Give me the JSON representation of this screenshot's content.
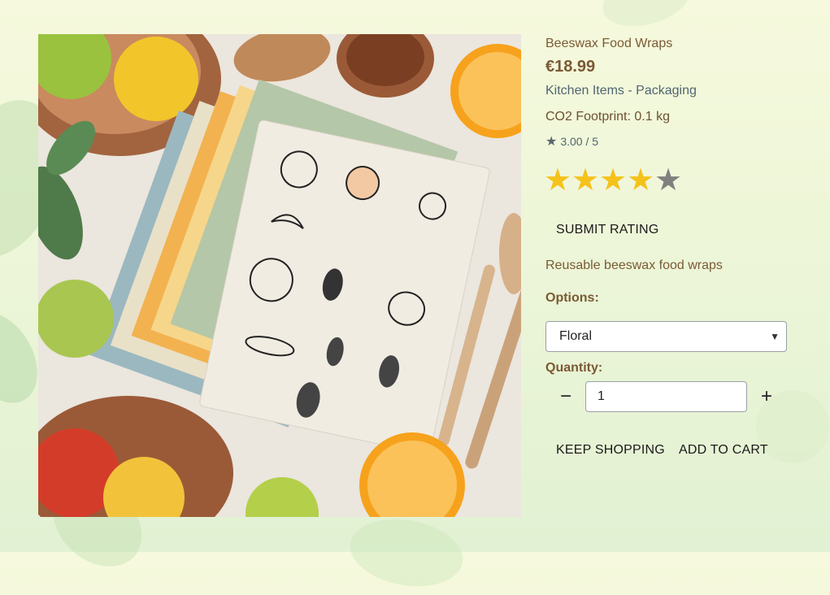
{
  "product": {
    "name": "Beeswax Food Wraps",
    "price": "€18.99",
    "category": "Kitchen Items - Packaging",
    "co2": "CO2 Footprint: 0.1 kg",
    "average_rating": "3.00 / 5",
    "description": "Reusable beeswax food wraps"
  },
  "rating_widget": {
    "selected": 4,
    "max": 5,
    "star_glyph": "★",
    "active_color": "#f5c21b",
    "inactive_color": "#808080",
    "submit_label": "SUBMIT RATING"
  },
  "options": {
    "label": "Options:",
    "selected": "Floral"
  },
  "quantity": {
    "label": "Quantity:",
    "value": "1",
    "minus_icon": "minus-icon",
    "plus_icon": "plus-icon"
  },
  "actions": {
    "keep_shopping": "KEEP SHOPPING",
    "add_to_cart": "ADD TO CART"
  },
  "colors": {
    "brand_text": "#7a5a34",
    "category_text": "#4f6670"
  }
}
